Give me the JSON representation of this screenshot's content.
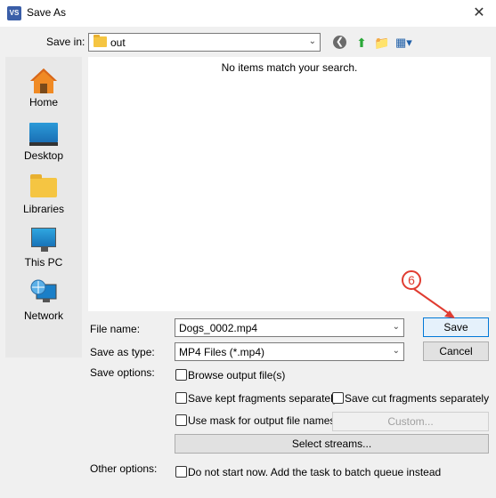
{
  "window": {
    "title": "Save As",
    "app_icon": "VS",
    "close_label": "✕"
  },
  "toolbar": {
    "save_in_label": "Save in:",
    "save_in_value": "out",
    "icons": [
      "back-icon",
      "up-folder-icon",
      "new-folder-icon",
      "view-menu-icon"
    ]
  },
  "places": [
    {
      "label": "Home",
      "icon": "home-icon"
    },
    {
      "label": "Desktop",
      "icon": "desktop-icon"
    },
    {
      "label": "Libraries",
      "icon": "libraries-icon"
    },
    {
      "label": "This PC",
      "icon": "this-pc-icon"
    },
    {
      "label": "Network",
      "icon": "network-icon"
    }
  ],
  "filelist": {
    "empty_message": "No items match your search."
  },
  "form": {
    "file_name_label": "File name:",
    "file_name_value": "Dogs_0002.mp4",
    "save_as_type_label": "Save as type:",
    "save_as_type_value": "MP4 Files (*.mp4)",
    "save_options_label": "Save options:",
    "other_options_label": "Other options:",
    "browse_output": "Browse output file(s)",
    "save_kept": "Save kept fragments separately",
    "save_cut": "Save cut fragments separately",
    "use_mask": "Use mask for output file names",
    "custom_button": "Custom...",
    "select_streams_button": "Select streams...",
    "batch_queue": "Do not start now. Add the task to batch queue instead"
  },
  "buttons": {
    "save": "Save",
    "cancel": "Cancel"
  },
  "annotation": {
    "step": "6",
    "color": "#e03c31"
  }
}
